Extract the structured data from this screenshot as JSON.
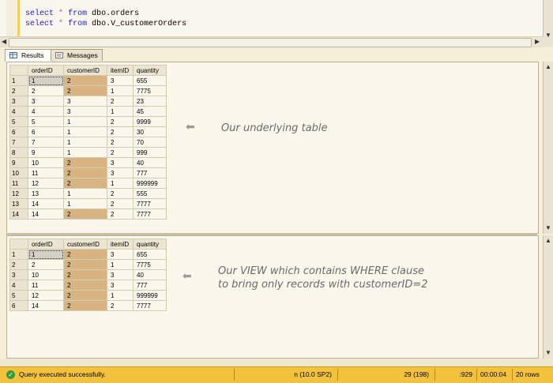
{
  "editor": {
    "line1": {
      "kw": "select",
      "op": "*",
      "kw2": "from",
      "rest": "dbo.orders"
    },
    "line2": {
      "kw": "select",
      "op": "*",
      "kw2": "from",
      "rest": "dbo.V_customerOrders"
    }
  },
  "tabs": {
    "results": "Results",
    "messages": "Messages"
  },
  "columns": [
    "orderID",
    "customerID",
    "itemID",
    "quantity"
  ],
  "table1": [
    [
      "1",
      "1",
      "2",
      "3",
      "655"
    ],
    [
      "2",
      "2",
      "2",
      "1",
      "7775"
    ],
    [
      "3",
      "3",
      "3",
      "2",
      "23"
    ],
    [
      "4",
      "4",
      "3",
      "1",
      "45"
    ],
    [
      "5",
      "5",
      "1",
      "2",
      "9999"
    ],
    [
      "6",
      "6",
      "1",
      "2",
      "30"
    ],
    [
      "7",
      "7",
      "1",
      "2",
      "70"
    ],
    [
      "8",
      "9",
      "1",
      "2",
      "999"
    ],
    [
      "9",
      "10",
      "2",
      "3",
      "40"
    ],
    [
      "10",
      "11",
      "2",
      "3",
      "777"
    ],
    [
      "11",
      "12",
      "2",
      "1",
      "999999"
    ],
    [
      "12",
      "13",
      "1",
      "2",
      "555"
    ],
    [
      "13",
      "14",
      "1",
      "2",
      "7777"
    ],
    [
      "14",
      "14",
      "2",
      "2",
      "7777"
    ]
  ],
  "table2": [
    [
      "1",
      "1",
      "2",
      "3",
      "655"
    ],
    [
      "2",
      "2",
      "2",
      "1",
      "7775"
    ],
    [
      "3",
      "10",
      "2",
      "3",
      "40"
    ],
    [
      "4",
      "11",
      "2",
      "3",
      "777"
    ],
    [
      "5",
      "12",
      "2",
      "1",
      "999999"
    ],
    [
      "6",
      "14",
      "2",
      "2",
      "7777"
    ]
  ],
  "annotations": {
    "table1": "Our underlying table",
    "table2_line1": "Our VIEW which contains WHERE clause",
    "table2_line2": "to bring only records with customerID=2"
  },
  "status": {
    "message": "Query executed successfully.",
    "server": "n (10.0 SP2)",
    "user": "29 (198)",
    "spid": ":929",
    "time": "00:00:04",
    "rows": "20 rows"
  },
  "colors": {
    "highlight": "#d8b482",
    "status_bar": "#f3c23c"
  }
}
